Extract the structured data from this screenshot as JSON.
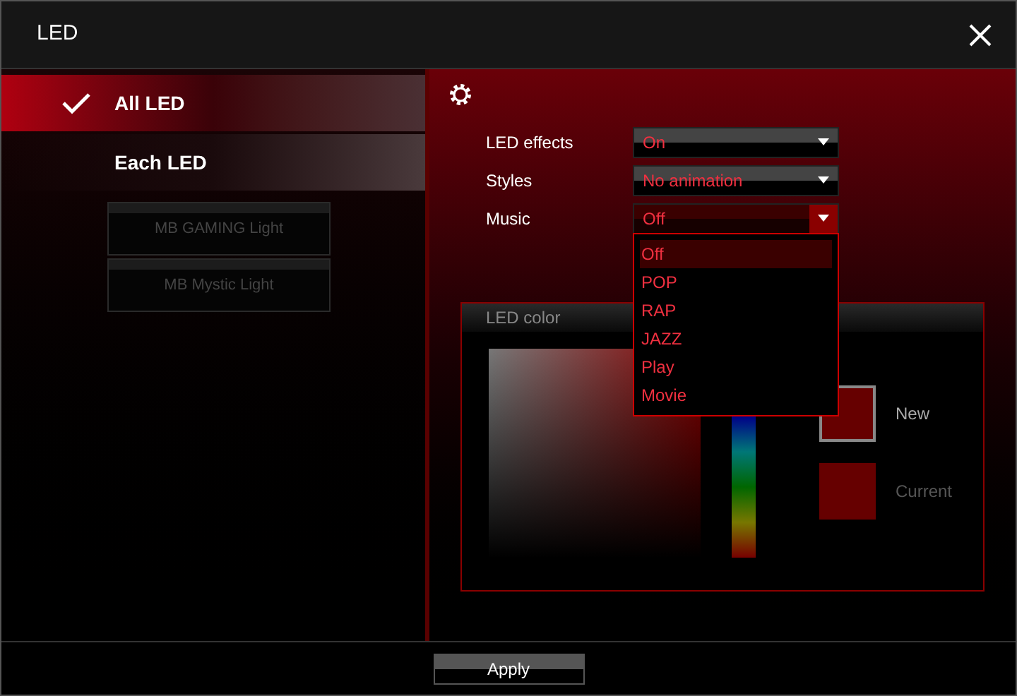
{
  "window": {
    "title": "LED"
  },
  "nav": [
    {
      "label": "All LED",
      "selected": true
    },
    {
      "label": "Each LED",
      "selected": false
    }
  ],
  "sub_buttons": [
    {
      "label": "MB GAMING Light",
      "disabled": true
    },
    {
      "label": "MB Mystic Light",
      "disabled": true
    }
  ],
  "settings": [
    {
      "label": "LED effects",
      "value": "On",
      "open": false
    },
    {
      "label": "Styles",
      "value": "No animation",
      "open": false
    },
    {
      "label": "Music",
      "value": "Off",
      "open": true,
      "options": [
        {
          "label": "Off",
          "selected": true
        },
        {
          "label": "POP",
          "selected": false
        },
        {
          "label": "RAP",
          "selected": false
        },
        {
          "label": "JAZZ",
          "selected": false
        },
        {
          "label": "Play",
          "selected": false
        },
        {
          "label": "Movie",
          "selected": false
        }
      ]
    }
  ],
  "led_color": {
    "title": "LED color",
    "swatches": [
      {
        "label": "New",
        "color": "#660000",
        "selected": true
      },
      {
        "label": "Current",
        "color": "#660000",
        "selected": false
      }
    ]
  },
  "apply_button": "Apply"
}
